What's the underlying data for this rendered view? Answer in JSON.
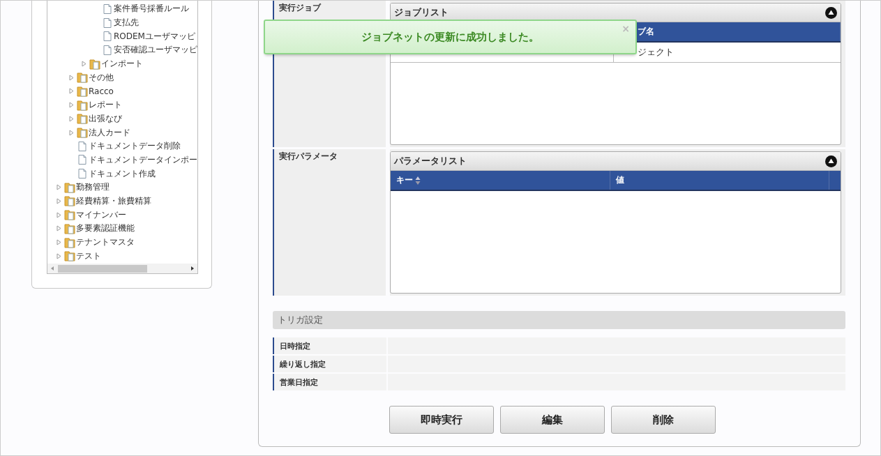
{
  "tree": {
    "items": [
      {
        "children": [
          {
            "children": [
              {
                "children": [
                  {
                    "label": "案件番号採番ルール",
                    "kind": "file"
                  },
                  {
                    "label": "支払先",
                    "kind": "file"
                  },
                  {
                    "label": "RODEMユーザマッピ",
                    "kind": "file"
                  },
                  {
                    "label": "安否確認ユーザマッピ",
                    "kind": "file"
                  }
                ]
              },
              {
                "label": "インポート",
                "kind": "folder",
                "expanded": false
              }
            ]
          },
          {
            "label": "その他",
            "kind": "folder",
            "expanded": false
          },
          {
            "label": "Racco",
            "kind": "folder",
            "expanded": false
          },
          {
            "label": "レポート",
            "kind": "folder",
            "expanded": false
          },
          {
            "label": "出張なび",
            "kind": "folder",
            "expanded": false
          },
          {
            "label": "法人カード",
            "kind": "folder",
            "expanded": false
          },
          {
            "label": "ドキュメントデータ削除",
            "kind": "file"
          },
          {
            "label": "ドキュメントデータインポー",
            "kind": "file"
          },
          {
            "label": "ドキュメント作成",
            "kind": "file"
          }
        ]
      },
      {
        "label": "勤務管理",
        "kind": "folder",
        "expanded": false
      },
      {
        "label": "経費精算・旅費精算",
        "kind": "folder",
        "expanded": false
      },
      {
        "label": "マイナンバー",
        "kind": "folder",
        "expanded": false
      },
      {
        "label": "多要素認証機能",
        "kind": "folder",
        "expanded": false
      },
      {
        "label": "テナントマスタ",
        "kind": "folder",
        "expanded": false
      },
      {
        "label": "テスト",
        "kind": "folder",
        "expanded": false
      }
    ]
  },
  "sections": [
    {
      "label": "実行ジョブ",
      "list_title": "ジョブリスト",
      "columns": [
        {
          "label": "ブ名"
        }
      ],
      "rows": [
        [
          "ジェクト"
        ]
      ]
    },
    {
      "label": "実行パラメータ",
      "list_title": "パラメータリスト",
      "columns": [
        {
          "label": "キー",
          "sortable": true
        },
        {
          "label": "値",
          "sortable": false
        }
      ]
    }
  ],
  "trigger": {
    "title": "トリガ設定",
    "rows": [
      {
        "label": "日時指定"
      },
      {
        "label": "繰り返し指定"
      },
      {
        "label": "営業日指定"
      }
    ]
  },
  "buttons": [
    "即時実行",
    "編集",
    "削除"
  ],
  "toast": {
    "message": "ジョブネットの更新に成功しました。",
    "close": "×"
  }
}
